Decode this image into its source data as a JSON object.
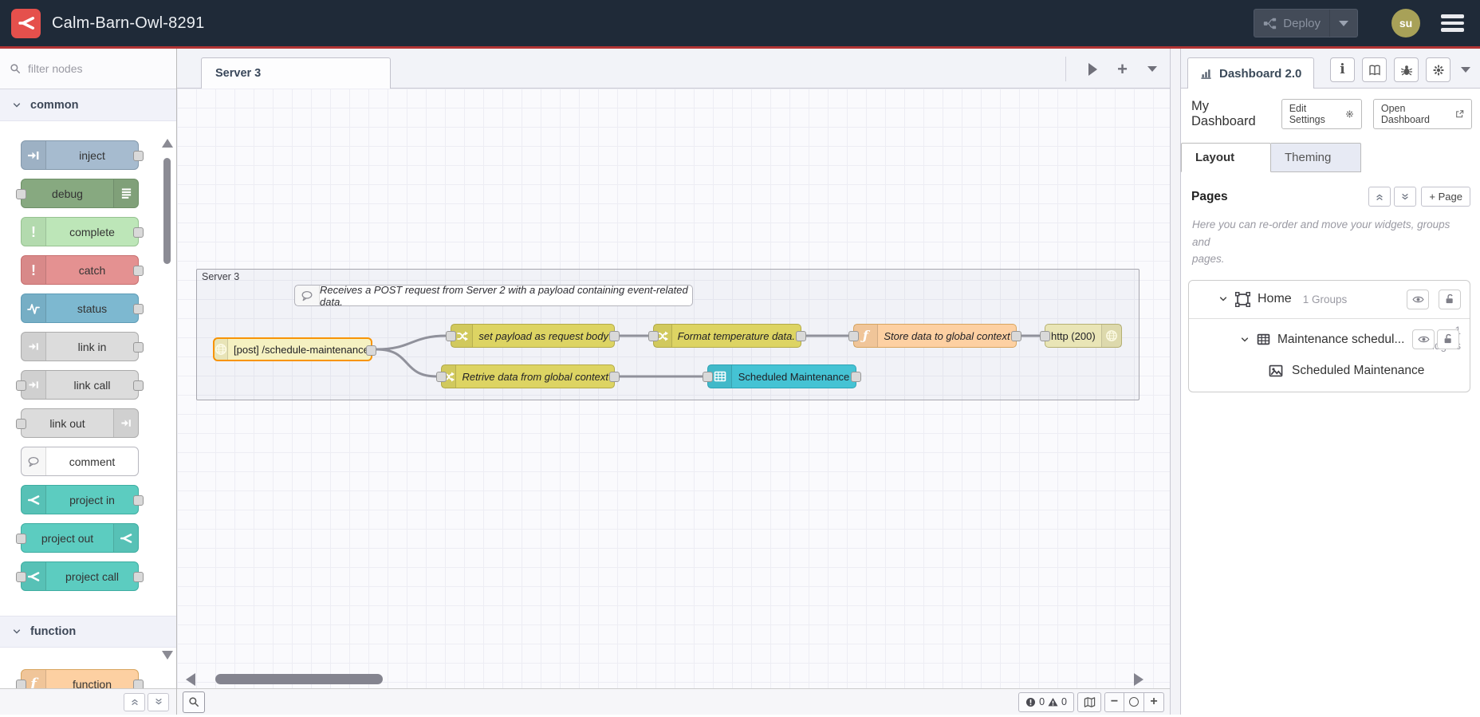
{
  "header": {
    "title": "Calm-Barn-Owl-8291",
    "deploy": {
      "label": "Deploy",
      "icon": "deploy-icon",
      "caret_icon": "chevron-down-icon"
    },
    "avatar": "su",
    "menu_icon": "hamburger-icon",
    "logo_icon": "node-red-logo"
  },
  "palette": {
    "filter_placeholder": "filter nodes",
    "search_icon": "search-icon",
    "categories": [
      {
        "label": "common",
        "nodes": [
          {
            "label": "inject",
            "icon": "inject-arrow-icon"
          },
          {
            "label": "debug",
            "icon": "debug-list-icon"
          },
          {
            "label": "complete",
            "icon": "exclamation-icon"
          },
          {
            "label": "catch",
            "icon": "exclamation-icon"
          },
          {
            "label": "status",
            "icon": "heartbeat-icon"
          },
          {
            "label": "link in",
            "icon": "link-arrow-icon"
          },
          {
            "label": "link call",
            "icon": "link-arrow-icon"
          },
          {
            "label": "link out",
            "icon": "link-arrow-icon"
          },
          {
            "label": "comment",
            "icon": "speech-bubble-icon"
          },
          {
            "label": "project in",
            "icon": "node-red-logo"
          },
          {
            "label": "project out",
            "icon": "node-red-logo"
          },
          {
            "label": "project call",
            "icon": "node-red-logo"
          }
        ]
      },
      {
        "label": "function",
        "nodes": [
          {
            "label": "function",
            "icon": "function-f-icon"
          }
        ]
      }
    ]
  },
  "workspace": {
    "tab": "Server 3",
    "toolbar_icons": [
      "play-icon",
      "plus-icon",
      "chevron-down-icon"
    ],
    "group_label": "Server 3",
    "comment_text": "Receives a POST request from Server 2 with a payload containing event-related data.",
    "nodes": {
      "http_in": "[post] /schedule-maintenance",
      "set_payload": "set payload as request body",
      "format": "Format temperature data.",
      "store": "Store data to global context",
      "http_response": "http (200)",
      "retrieve": "Retrive data from global context",
      "table": "Scheduled Maintenance"
    },
    "status": {
      "errors": "0",
      "warnings": "0"
    }
  },
  "sidebar": {
    "active_tab": "Dashboard 2.0",
    "tab_icon": "bar-chart-icon",
    "toolbar_icons": [
      "info-icon",
      "book-icon",
      "bug-icon",
      "gear-icon",
      "chevron-down-icon"
    ],
    "title": "My Dashboard",
    "edit_settings": "Edit Settings",
    "open_dashboard": "Open Dashboard",
    "tabs": {
      "layout": "Layout",
      "theming": "Theming"
    },
    "pages": {
      "heading": "Pages",
      "add_page": "+ Page",
      "help": "Here you can re-order and move your widgets, groups and\npages."
    },
    "tree": {
      "page_label": "Home",
      "page_meta": "1 Groups",
      "group_label": "Maintenance schedul...",
      "group_meta": "1 Widgets",
      "widget_label": "Scheduled Maintenance",
      "row_icons": [
        "object-group-icon",
        "table-grid-icon",
        "image-icon"
      ],
      "row_buttons": [
        "eye-icon",
        "unlock-icon"
      ]
    }
  },
  "colors": {
    "header_bg": "#1f2a38",
    "accent_red": "#b23434",
    "node_yellow": "#ddd463",
    "node_orange": "#fdd0a2",
    "node_cyan": "#45c3d4",
    "node_teal": "#5cccc0",
    "http_in_border": "#f89406"
  }
}
